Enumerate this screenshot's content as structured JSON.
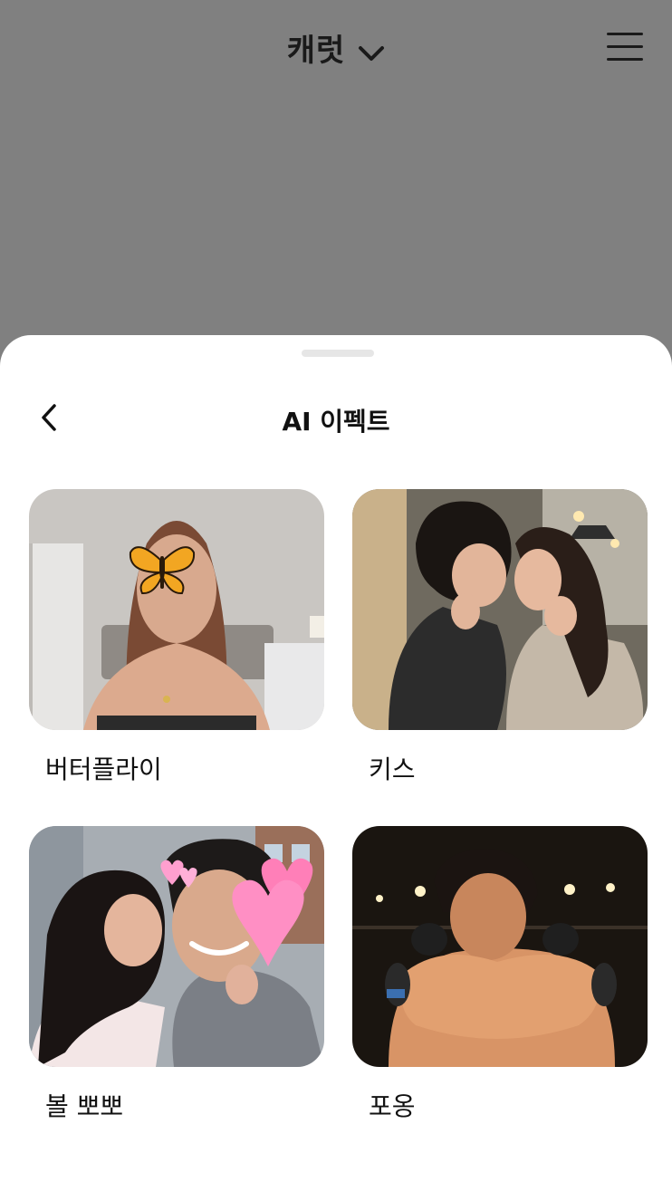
{
  "header": {
    "title": "캐럿",
    "dropdown_icon": "chevron-down-icon",
    "menu_icon": "hamburger-menu-icon"
  },
  "sheet": {
    "title": "AI 이펙트",
    "back_icon": "chevron-left-icon",
    "effects": [
      {
        "label": "버터플라이",
        "thumbnail": "butterfly-effect-photo"
      },
      {
        "label": "키스",
        "thumbnail": "kiss-effect-photo"
      },
      {
        "label": "볼 뽀뽀",
        "thumbnail": "cheek-kiss-effect-photo"
      },
      {
        "label": "포옹",
        "thumbnail": "hug-effect-photo"
      }
    ]
  },
  "colors": {
    "overlay": "#808080",
    "sheet_bg": "#ffffff",
    "text": "#111111",
    "handle": "#e6e6e6"
  }
}
